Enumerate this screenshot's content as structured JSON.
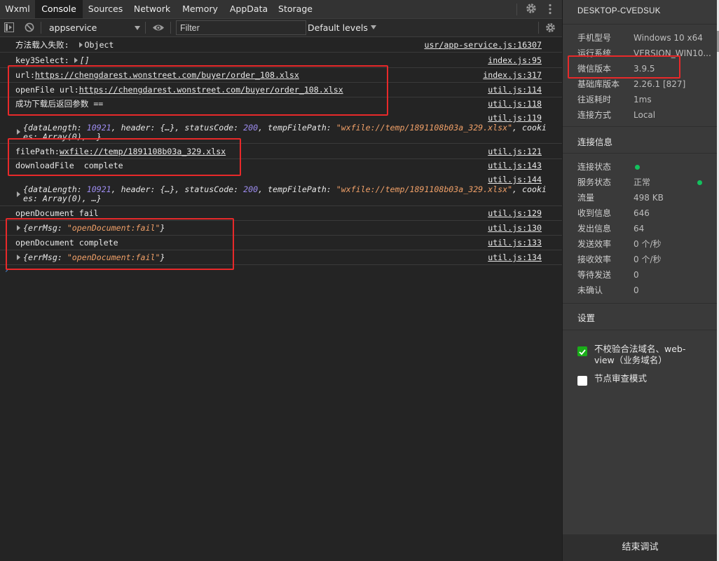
{
  "tabs": [
    "Wxml",
    "Console",
    "Sources",
    "Network",
    "Memory",
    "AppData",
    "Storage"
  ],
  "toolbar": {
    "context": "appservice",
    "filter_placeholder": "Filter",
    "levels": "Default levels"
  },
  "console": [
    {
      "text": "方法载入失败:",
      "obj": "Object",
      "src": "usr/app-service.js:16307"
    },
    {
      "text": "key3Select:",
      "obj": "[]",
      "src": "index.js:95"
    },
    {
      "prefix": "url:",
      "link": "https://chengdarest.wonstreet.com/buyer/order_108.xlsx",
      "src": "index.js:317"
    },
    {
      "prefix": "openFile url:",
      "link": "https://chengdarest.wonstreet.com/buyer/order_108.xlsx",
      "src": "util.js:114"
    },
    {
      "text": "成功下载后返回参数 ==",
      "src": "util.js:118"
    },
    {
      "src": "util.js:119",
      "data_length": "10921",
      "status_code": "200",
      "temp_path": "\"wxfile://temp/1891108b03a_329.xlsx\"",
      "tail": ", cookies: Array(0), …}"
    },
    {
      "prefix": "filePath:",
      "link": "wxfile://temp/1891108b03a_329.xlsx",
      "src": "util.js:121"
    },
    {
      "text": "downloadFile  complete",
      "src": "util.js:143"
    },
    {
      "src": "util.js:144",
      "data_length": "10921",
      "status_code": "200",
      "temp_path": "\"wxfile://temp/1891108b03a_329.xlsx\"",
      "tail": ", cookies: Array(0), …}"
    },
    {
      "text": "openDocument fail",
      "src": "util.js:129"
    },
    {
      "err": "\"openDocument:fail\"",
      "src": "util.js:130"
    },
    {
      "text": "openDocument complete",
      "src": "util.js:133"
    },
    {
      "err": "\"openDocument:fail\"",
      "src": "util.js:134"
    }
  ],
  "panel": {
    "device": "DESKTOP-CVEDSUK",
    "info": [
      {
        "k": "手机型号",
        "v": "Windows 10 x64"
      },
      {
        "k": "运行系统",
        "v": "VERSION_WIN10..."
      },
      {
        "k": "微信版本",
        "v": "3.9.5"
      },
      {
        "k": "基础库版本",
        "v": "2.26.1 [827]"
      },
      {
        "k": "往返耗时",
        "v": "1ms"
      },
      {
        "k": "连接方式",
        "v": "Local"
      }
    ],
    "conn_title": "连接信息",
    "conn": [
      {
        "k": "连接状态",
        "v": ""
      },
      {
        "k": "服务状态",
        "v": "正常"
      },
      {
        "k": "流量",
        "v": "498 KB"
      },
      {
        "k": "收到信息",
        "v": "646"
      },
      {
        "k": "发出信息",
        "v": "64"
      },
      {
        "k": "发送效率",
        "v": "0 个/秒"
      },
      {
        "k": "接收效率",
        "v": "0 个/秒"
      },
      {
        "k": "等待发送",
        "v": "0"
      },
      {
        "k": "未确认",
        "v": "0"
      }
    ],
    "settings_title": "设置",
    "opt_domain": "不校验合法域名、web-view（业务域名）",
    "opt_audit": "节点审查模式",
    "end_debug": "结束调试",
    "status_color": "#13c15e"
  }
}
